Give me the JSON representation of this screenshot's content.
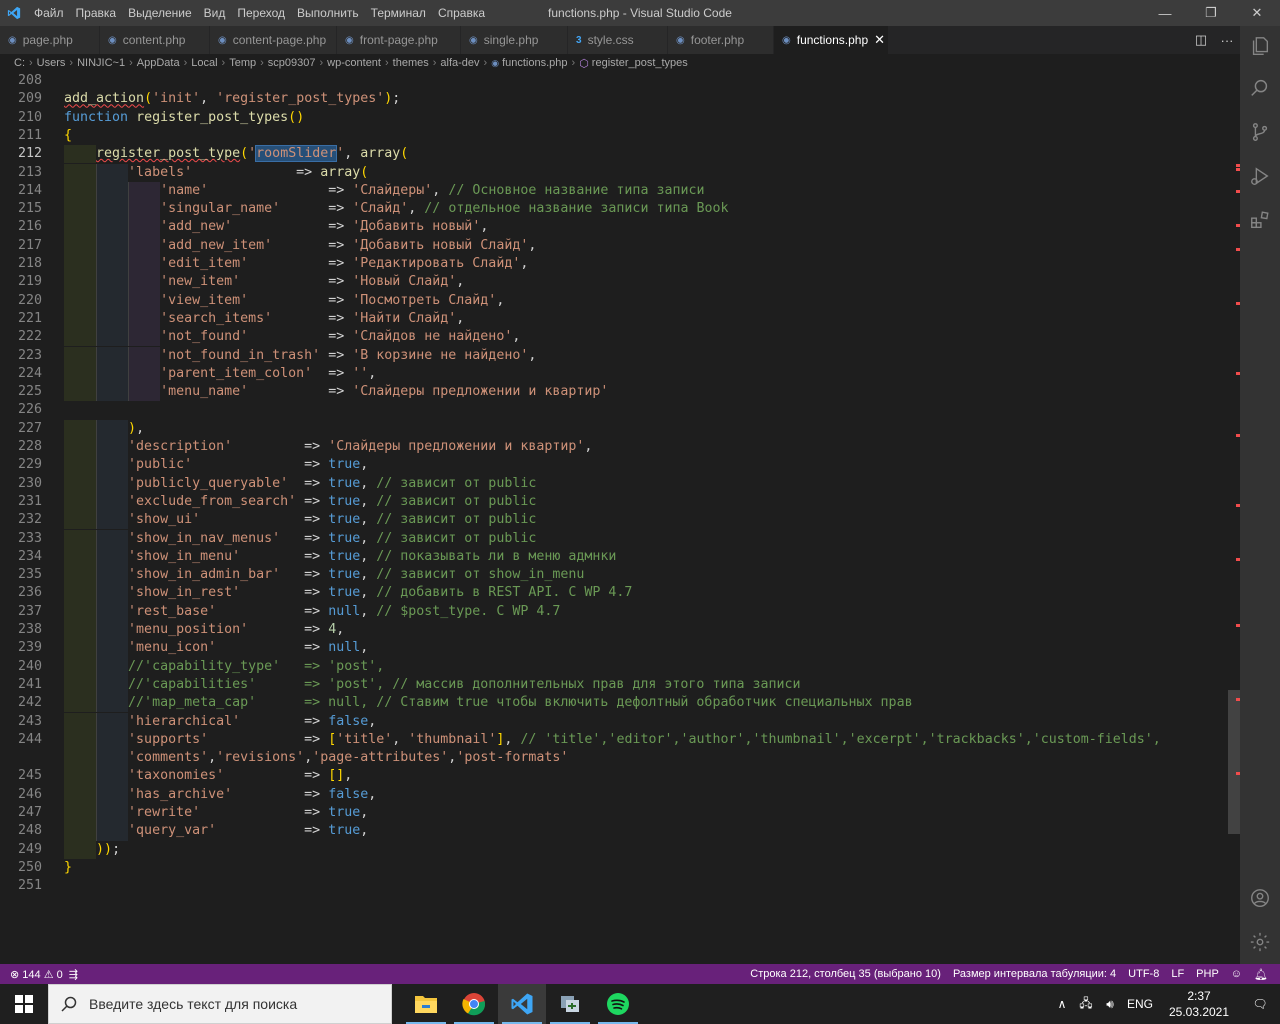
{
  "titlebar": {
    "menu": [
      "Файл",
      "Правка",
      "Выделение",
      "Вид",
      "Переход",
      "Выполнить",
      "Терминал",
      "Справка"
    ],
    "title": "functions.php - Visual Studio Code",
    "minimize": "—",
    "maximize": "❐",
    "close": "✕"
  },
  "tabs": [
    {
      "label": "page.php",
      "icon": "php-icon"
    },
    {
      "label": "content.php",
      "icon": "php-icon"
    },
    {
      "label": "content-page.php",
      "icon": "php-icon"
    },
    {
      "label": "front-page.php",
      "icon": "php-icon"
    },
    {
      "label": "single.php",
      "icon": "php-icon"
    },
    {
      "label": "style.css",
      "icon": "css-icon"
    },
    {
      "label": "footer.php",
      "icon": "php-icon"
    },
    {
      "label": "functions.php",
      "icon": "php-icon",
      "active": true
    }
  ],
  "tab_actions": {
    "split": "◫",
    "more": "···"
  },
  "breadcrumb": [
    "C:",
    "Users",
    "NINJIC~1",
    "AppData",
    "Local",
    "Temp",
    "scp09307",
    "wp-content",
    "themes",
    "alfa-dev",
    "functions.php",
    "register_post_types"
  ],
  "editor": {
    "current_line": 212,
    "lines": [
      {
        "n": "208",
        "t": ""
      },
      {
        "n": "209",
        "t": "add_action('init', 'register_post_types');"
      },
      {
        "n": "210",
        "t": "function register_post_types()"
      },
      {
        "n": "211",
        "t": "{"
      },
      {
        "n": "212",
        "t": "    register_post_type('roomSlider', array("
      },
      {
        "n": "213",
        "t": "        'labels'             => array("
      },
      {
        "n": "214",
        "t": "            'name'               => 'Слайдеры', // Основное название типа записи"
      },
      {
        "n": "215",
        "t": "            'singular_name'      => 'Слайд', // отдельное название записи типа Book"
      },
      {
        "n": "216",
        "t": "            'add_new'            => 'Добавить новый',"
      },
      {
        "n": "217",
        "t": "            'add_new_item'       => 'Добавить новый Слайд',"
      },
      {
        "n": "218",
        "t": "            'edit_item'          => 'Редактировать Слайд',"
      },
      {
        "n": "219",
        "t": "            'new_item'           => 'Новый Слайд',"
      },
      {
        "n": "220",
        "t": "            'view_item'          => 'Посмотреть Слайд',"
      },
      {
        "n": "221",
        "t": "            'search_items'       => 'Найти Слайд',"
      },
      {
        "n": "222",
        "t": "            'not_found'          => 'Слайдов не найдено',"
      },
      {
        "n": "223",
        "t": "            'not_found_in_trash' => 'В корзине не найдено',"
      },
      {
        "n": "224",
        "t": "            'parent_item_colon'  => '',"
      },
      {
        "n": "225",
        "t": "            'menu_name'          => 'Слайдеры предложении и квартир'"
      },
      {
        "n": "226",
        "t": ""
      },
      {
        "n": "227",
        "t": "        ),"
      },
      {
        "n": "228",
        "t": "        'description'         => 'Слайдеры предложении и квартир',"
      },
      {
        "n": "229",
        "t": "        'public'              => true,"
      },
      {
        "n": "230",
        "t": "        'publicly_queryable'  => true, // зависит от public"
      },
      {
        "n": "231",
        "t": "        'exclude_from_search' => true, // зависит от public"
      },
      {
        "n": "232",
        "t": "        'show_ui'             => true, // зависит от public"
      },
      {
        "n": "233",
        "t": "        'show_in_nav_menus'   => true, // зависит от public"
      },
      {
        "n": "234",
        "t": "        'show_in_menu'        => true, // показывать ли в меню адмнки"
      },
      {
        "n": "235",
        "t": "        'show_in_admin_bar'   => true, // зависит от show_in_menu"
      },
      {
        "n": "236",
        "t": "        'show_in_rest'        => true, // добавить в REST API. C WP 4.7"
      },
      {
        "n": "237",
        "t": "        'rest_base'           => null, // $post_type. C WP 4.7"
      },
      {
        "n": "238",
        "t": "        'menu_position'       => 4,"
      },
      {
        "n": "239",
        "t": "        'menu_icon'           => null,"
      },
      {
        "n": "240",
        "t": "        //'capability_type'   => 'post',"
      },
      {
        "n": "241",
        "t": "        //'capabilities'      => 'post', // массив дополнительных прав для этого типа записи"
      },
      {
        "n": "242",
        "t": "        //'map_meta_cap'      => null, // Ставим true чтобы включить дефолтный обработчик специальных прав"
      },
      {
        "n": "243",
        "t": "        'hierarchical'        => false,"
      },
      {
        "n": "244",
        "t": "        'supports'            => ['title', 'thumbnail'], // 'title','editor','author','thumbnail','excerpt','trackbacks','custom-fields',"
      },
      {
        "n": "",
        "t": "        'comments','revisions','page-attributes','post-formats'"
      },
      {
        "n": "245",
        "t": "        'taxonomies'          => [],"
      },
      {
        "n": "246",
        "t": "        'has_archive'         => false,"
      },
      {
        "n": "247",
        "t": "        'rewrite'             => true,"
      },
      {
        "n": "248",
        "t": "        'query_var'           => true,"
      },
      {
        "n": "249",
        "t": "    ));"
      },
      {
        "n": "250",
        "t": "}"
      },
      {
        "n": "251",
        "t": ""
      }
    ]
  },
  "statusbar": {
    "errors": "144",
    "warnings": "0",
    "position": "Строка 212, столбец 35 (выбрано 10)",
    "indent": "Размер интервала табуляции: 4",
    "encoding": "UTF-8",
    "eol": "LF",
    "language": "PHP"
  },
  "taskbar": {
    "search_placeholder": "Введите здесь текст для поиска",
    "lang": "ENG",
    "time": "2:37",
    "date": "25.03.2021"
  },
  "colors": {
    "statusbar": "#68217a",
    "titlebar": "#3c3c3c",
    "editor_bg": "#1e1e1e",
    "keyword": "#569cd6",
    "string": "#ce9178",
    "comment": "#6a9955",
    "function": "#dcdcaa"
  }
}
